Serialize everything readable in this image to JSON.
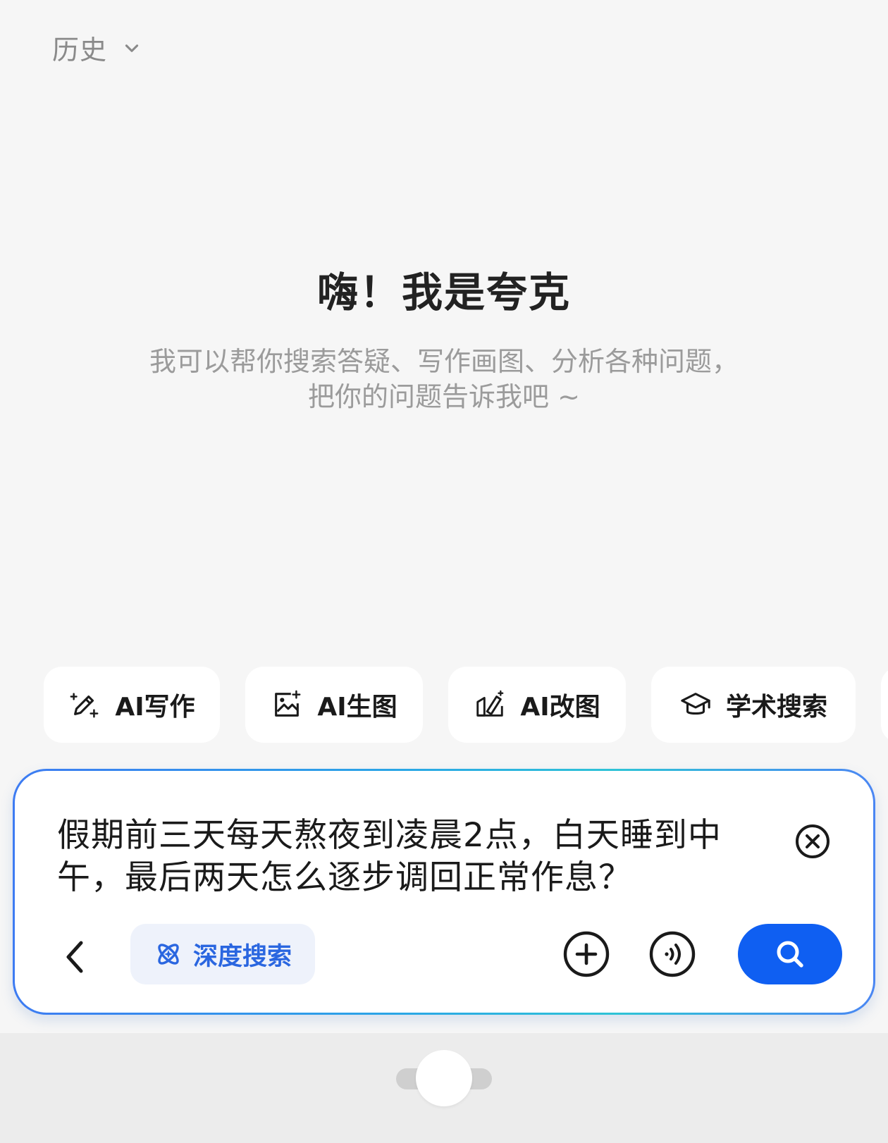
{
  "header": {
    "title": "历史",
    "dropdown_icon": "chevron-down-icon"
  },
  "welcome": {
    "title": "嗨！我是夸克",
    "subtitle_line1": "我可以帮你搜索答疑、写作画图、分析各种问题，",
    "subtitle_line2": "把你的问题告诉我吧 ~"
  },
  "quick_actions": [
    {
      "label": "AI写作",
      "icon": "ai-writing-icon"
    },
    {
      "label": "AI生图",
      "icon": "ai-image-icon"
    },
    {
      "label": "AI改图",
      "icon": "ai-edit-image-icon"
    },
    {
      "label": "学术搜索",
      "icon": "graduation-cap-icon"
    }
  ],
  "input": {
    "query": "假期前三天每天熬夜到凌晨2点，白天睡到中午，最后两天怎么逐步调回正常作息？",
    "deep_search_label": "深度搜索",
    "deep_search_icon": "atom-icon",
    "clear_icon": "clear-icon",
    "back_icon": "chevron-left-icon",
    "add_icon": "plus-circle-icon",
    "voice_icon": "voice-icon",
    "search_icon": "search-icon"
  },
  "colors": {
    "accent": "#0f5ff2",
    "deep_search_text": "#2a66e0",
    "deep_search_bg": "#eef2fb",
    "background": "#f6f6f6"
  }
}
